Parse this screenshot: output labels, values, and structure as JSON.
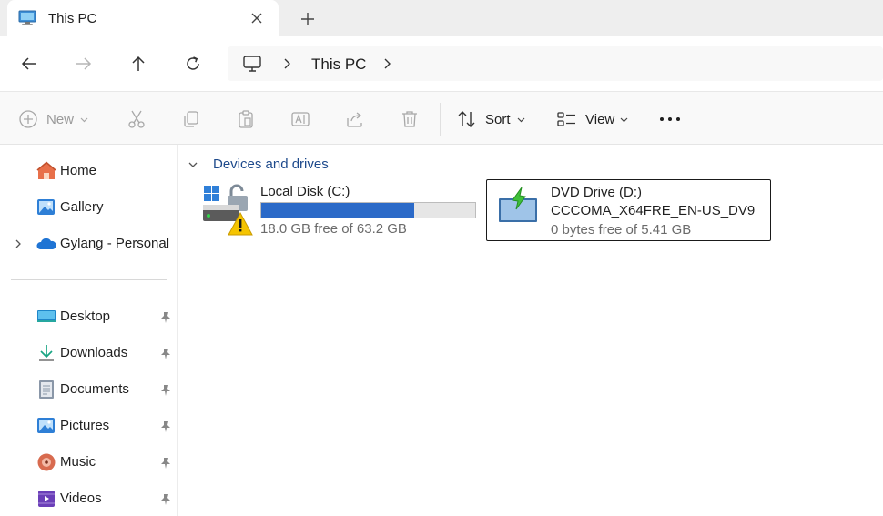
{
  "tab": {
    "title": "This PC"
  },
  "address": {
    "crumb": "This PC"
  },
  "toolbar": {
    "new_label": "New",
    "sort_label": "Sort",
    "view_label": "View"
  },
  "sidebar": {
    "items": [
      {
        "label": "Home",
        "icon": "home-icon"
      },
      {
        "label": "Gallery",
        "icon": "gallery-icon"
      },
      {
        "label": "Gylang - Personal",
        "icon": "onedrive-icon"
      }
    ],
    "quick_access": [
      {
        "label": "Desktop",
        "icon": "desktop-folder-icon"
      },
      {
        "label": "Downloads",
        "icon": "downloads-folder-icon"
      },
      {
        "label": "Documents",
        "icon": "documents-folder-icon"
      },
      {
        "label": "Pictures",
        "icon": "pictures-folder-icon"
      },
      {
        "label": "Music",
        "icon": "music-folder-icon"
      },
      {
        "label": "Videos",
        "icon": "videos-folder-icon"
      }
    ]
  },
  "main": {
    "group_title": "Devices and drives",
    "drives": [
      {
        "name": "Local Disk (C:)",
        "free_text": "18.0 GB free of 63.2 GB",
        "used_fraction": 0.715
      },
      {
        "name": "DVD Drive (D:)",
        "label": "CCCOMA_X64FRE_EN-US_DV9",
        "free_text": "0 bytes free of 5.41 GB"
      }
    ]
  },
  "colors": {
    "accent": "#2b6ac8",
    "group_title": "#1e4a8c",
    "toolbar_bg": "#f9f9f9",
    "tabbar_bg": "#eeeeee"
  }
}
